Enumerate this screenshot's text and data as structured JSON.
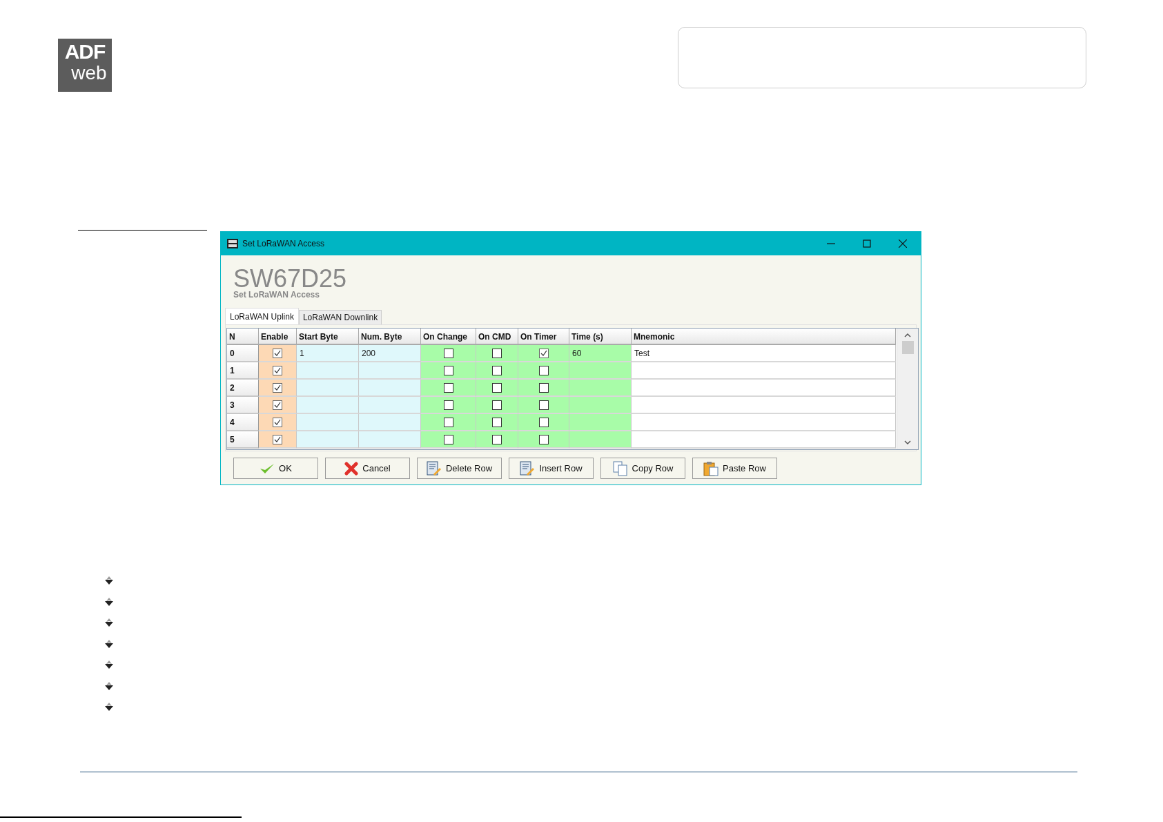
{
  "logo": {
    "line1": "ADF",
    "line2": "web"
  },
  "window": {
    "title": "Set LoRaWAN Access",
    "heading": "SW67D25",
    "subheading": "Set LoRaWAN Access"
  },
  "tabs": [
    {
      "label": "LoRaWAN Uplink",
      "selected": true
    },
    {
      "label": "LoRaWAN Downlink",
      "selected": false
    }
  ],
  "table": {
    "columns": [
      {
        "label": "N",
        "kind": "index"
      },
      {
        "label": "Enable",
        "kind": "check"
      },
      {
        "label": "Start Byte",
        "kind": "text"
      },
      {
        "label": "Num. Byte",
        "kind": "text"
      },
      {
        "label": "On Change",
        "kind": "check"
      },
      {
        "label": "On CMD",
        "kind": "check"
      },
      {
        "label": "On Timer",
        "kind": "check"
      },
      {
        "label": "Time (s)",
        "kind": "text"
      },
      {
        "label": "Mnemonic",
        "kind": "text"
      }
    ],
    "rows": [
      {
        "cells": [
          {
            "text": "0"
          },
          {
            "checked": true
          },
          {
            "text": "1"
          },
          {
            "text": "200"
          },
          {
            "checked": false
          },
          {
            "checked": false
          },
          {
            "checked": true
          },
          {
            "text": "60"
          },
          {
            "text": "Test"
          }
        ]
      },
      {
        "cells": [
          {
            "text": "1"
          },
          {
            "checked": true
          },
          {},
          {},
          {
            "checked": false
          },
          {
            "checked": false
          },
          {
            "checked": false
          },
          {},
          {}
        ]
      },
      {
        "cells": [
          {
            "text": "2"
          },
          {
            "checked": true
          },
          {},
          {},
          {
            "checked": false
          },
          {
            "checked": false
          },
          {
            "checked": false
          },
          {},
          {}
        ]
      },
      {
        "cells": [
          {
            "text": "3"
          },
          {
            "checked": true
          },
          {},
          {},
          {
            "checked": false
          },
          {
            "checked": false
          },
          {
            "checked": false
          },
          {},
          {}
        ]
      },
      {
        "cells": [
          {
            "text": "4"
          },
          {
            "checked": true
          },
          {},
          {},
          {
            "checked": false
          },
          {
            "checked": false
          },
          {
            "checked": false
          },
          {},
          {}
        ]
      },
      {
        "cells": [
          {
            "text": "5"
          },
          {
            "checked": true
          },
          {},
          {},
          {
            "checked": false
          },
          {
            "checked": false
          },
          {
            "checked": false
          },
          {},
          {}
        ]
      }
    ]
  },
  "buttons": [
    {
      "label": "OK",
      "kind": "ok"
    },
    {
      "label": "Cancel",
      "kind": "cancel"
    },
    {
      "label": "Delete Row",
      "kind": "delete"
    },
    {
      "label": "Insert Row",
      "kind": "insert"
    },
    {
      "label": "Copy Row",
      "kind": "copy"
    },
    {
      "label": "Paste Row",
      "kind": "paste"
    }
  ]
}
